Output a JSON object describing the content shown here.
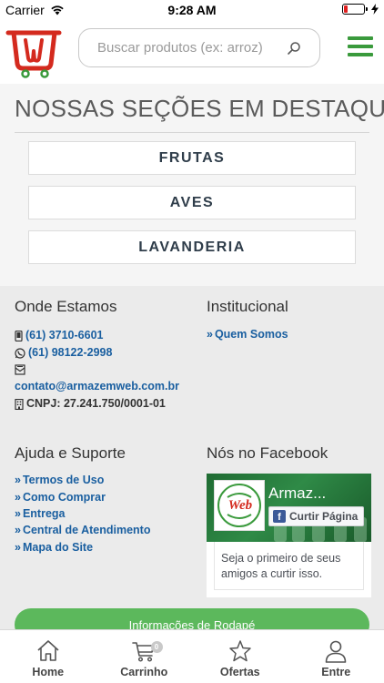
{
  "status_bar": {
    "carrier": "Carrier",
    "time": "9:28 AM",
    "battery_level": 0.2
  },
  "header": {
    "logo_icon": "cart-w-logo-icon",
    "search_placeholder": "Buscar produtos (ex: arroz)",
    "search_icon": "search-icon",
    "menu_icon": "hamburger-menu-icon",
    "brand_color": "#3a9a3c"
  },
  "sections": {
    "title": "NOSSAS SEÇÕES EM DESTAQUE",
    "items": [
      {
        "label": "FRUTAS"
      },
      {
        "label": "AVES"
      },
      {
        "label": "LAVANDERIA"
      }
    ]
  },
  "footer": {
    "location": {
      "heading": "Onde Estamos",
      "phone": "(61) 3710-6601",
      "whatsapp": "(61) 98122-2998",
      "email": "contato@armazemweb.com.br",
      "cnpj": "CNPJ: 27.241.750/0001-01"
    },
    "institutional": {
      "heading": "Institucional",
      "links": [
        {
          "label": "Quem Somos"
        }
      ]
    },
    "help": {
      "heading": "Ajuda e Suporte",
      "links": [
        {
          "label": "Termos de Uso"
        },
        {
          "label": "Como Comprar"
        },
        {
          "label": "Entrega"
        },
        {
          "label": "Central de Atendimento"
        },
        {
          "label": "Mapa do Site"
        }
      ]
    },
    "facebook": {
      "heading": "Nós no Facebook",
      "page_name": "Armaz...",
      "logo_text": "Web",
      "like_button": "Curtir Página",
      "text": "Seja o primeiro de seus amigos a curtir isso."
    },
    "info_button": "Informações de Rodapé",
    "link_color": "#1a5fa0",
    "button_color": "#5cb85c"
  },
  "tabbar": {
    "items": [
      {
        "label": "Home",
        "icon": "home-icon"
      },
      {
        "label": "Carrinho",
        "icon": "cart-icon",
        "badge": "0"
      },
      {
        "label": "Ofertas",
        "icon": "star-icon"
      },
      {
        "label": "Entre",
        "icon": "user-icon"
      }
    ]
  }
}
